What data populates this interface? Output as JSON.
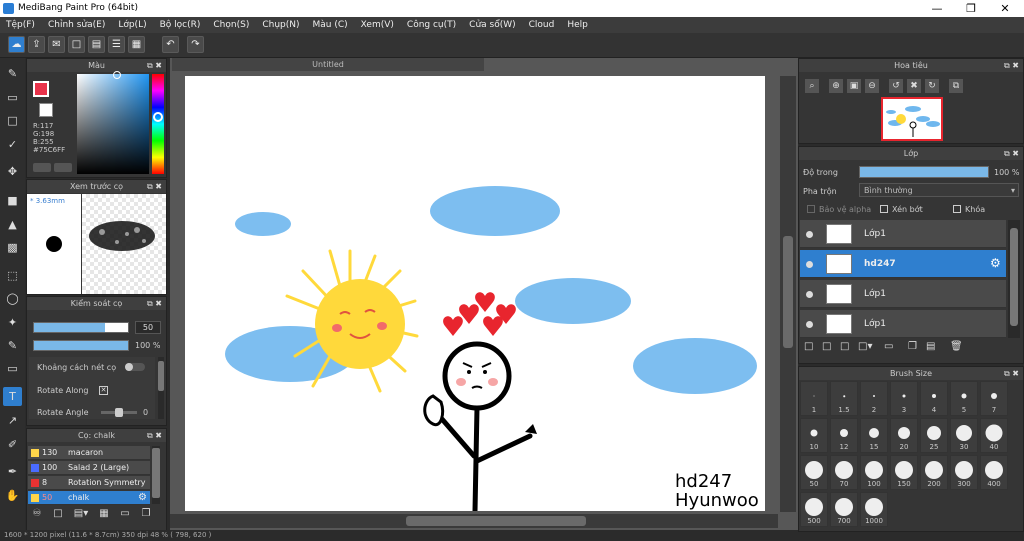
{
  "window": {
    "title": "MediBang Paint Pro (64bit)"
  },
  "menu": [
    "Tệp(F)",
    "Chỉnh sửa(E)",
    "Lớp(L)",
    "Bộ lọc(R)",
    "Chọn(S)",
    "Chụp(N)",
    "Màu (C)",
    "Xem(V)",
    "Công cụ(T)",
    "Cửa sổ(W)",
    "Cloud",
    "Help"
  ],
  "color_panel": {
    "title": "Màu",
    "r": "R:117",
    "g": "G:198",
    "b": "B:255",
    "hex": "#75C6FF",
    "primary": "#e8324a",
    "secondary": "#ffffff"
  },
  "preview_panel": {
    "title": "Xem trước cọ",
    "size": "* 3.63mm"
  },
  "brush_control": {
    "title": "Kiểm soát cọ",
    "size_val": "50",
    "opacity_val": "100 %",
    "spacing_label": "Khoảng cách nét cọ",
    "rotate_along": "Rotate Along",
    "rotate_angle": "Rotate Angle",
    "rotate_angle_val": "0",
    "size_fill": 0.75,
    "opacity_fill": 1.0
  },
  "brush_list": {
    "title": "Cọ: chalk",
    "items": [
      {
        "n": "130",
        "name": "macaron",
        "color": "#ffd54a"
      },
      {
        "n": "100",
        "name": "Salad 2 (Large)",
        "color": "#4a6cff"
      },
      {
        "n": "8",
        "name": "Rotation Symmetry",
        "color": "#e83232"
      },
      {
        "n": "50",
        "name": "chalk",
        "color": "#ffd54a"
      }
    ]
  },
  "document": {
    "tab": "Untitled",
    "sign_line1": "hd247",
    "sign_line2": "Hyunwoo"
  },
  "navigator": {
    "title": "Hoa tiêu"
  },
  "layer_panel": {
    "title": "Lớp",
    "opacity_label": "Độ trong",
    "opacity_val": "100 %",
    "opacity_fill": 1.0,
    "blend_label": "Pha trộn",
    "blend_val": "Bình thường",
    "alpha_label": "Bảo vệ alpha",
    "clip_label": "Xén bớt",
    "lock_label": "Khóa",
    "layers": [
      {
        "name": "Lớp1"
      },
      {
        "name": "hd247"
      },
      {
        "name": "Lớp1"
      },
      {
        "name": "Lớp1"
      }
    ]
  },
  "brush_size": {
    "title": "Brush Size",
    "sizes": [
      "1",
      "1.5",
      "2",
      "3",
      "4",
      "5",
      "7",
      "10",
      "12",
      "15",
      "20",
      "25",
      "30",
      "40",
      "50",
      "70",
      "100",
      "150",
      "200",
      "300",
      "400",
      "500",
      "700",
      "1000"
    ]
  },
  "status": {
    "text": "1600 * 1200 pixel  (11.6 * 8.7cm)  350 dpi  48 %  ( 798, 620 )"
  }
}
